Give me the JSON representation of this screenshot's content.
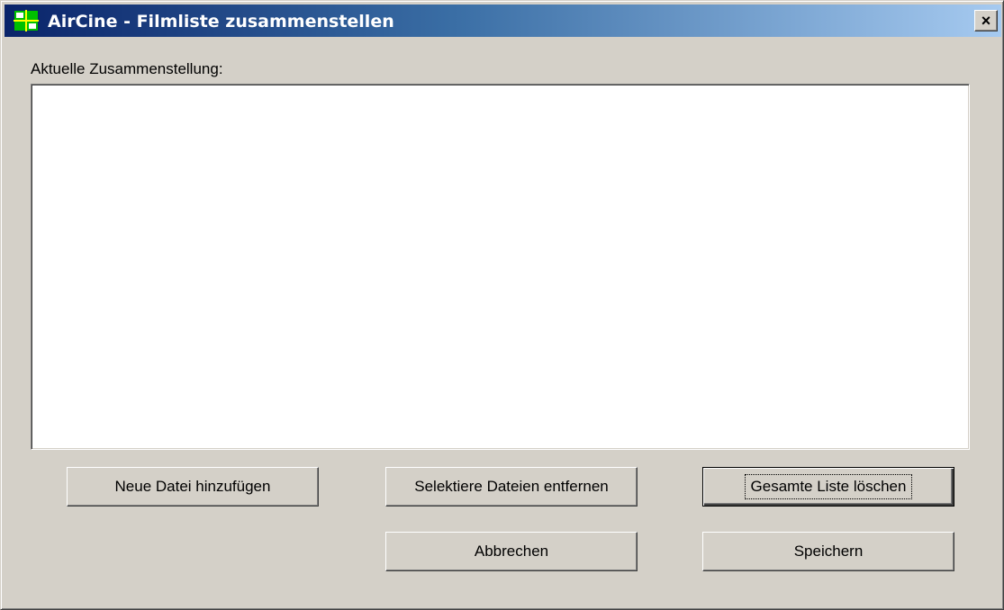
{
  "window": {
    "title": "AirCine - Filmliste zusammenstellen",
    "close_glyph": "×",
    "app_icon": "aircine-icon"
  },
  "list": {
    "label": "Aktuelle Zusammenstellung:",
    "items": []
  },
  "buttons": {
    "add_file": "Neue Datei hinzufügen",
    "remove_selected": "Selektiere Dateien entfernen",
    "clear_list": "Gesamte Liste löschen",
    "cancel": "Abbrechen",
    "save": "Speichern"
  },
  "colors": {
    "titlebar_start": "#0a246a",
    "titlebar_end": "#a6caf0",
    "dialog_background": "#d4d0c8",
    "list_background": "#ffffff"
  }
}
